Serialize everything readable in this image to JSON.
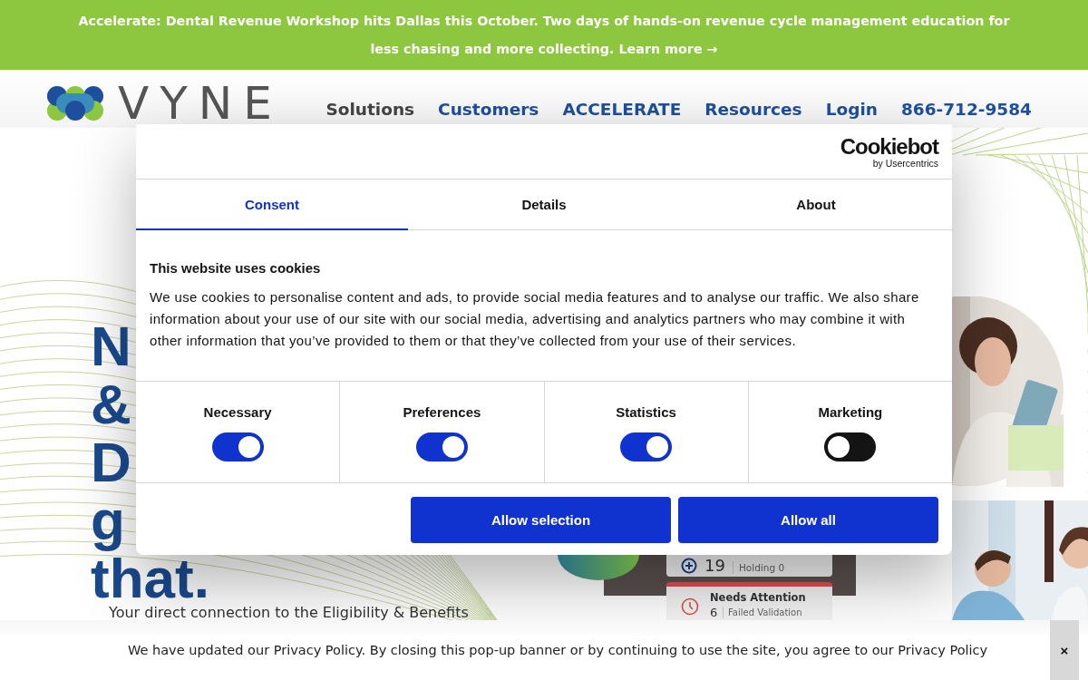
{
  "announcement": {
    "text": "Accelerate: Dental Revenue Workshop hits Dallas this October. Two days of hands-on revenue cycle management education for less chasing and more collecting.",
    "link": "Learn more →"
  },
  "header": {
    "logo": "VYNE",
    "nav": [
      {
        "label": "Solutions",
        "selected": true
      },
      {
        "label": "Customers",
        "selected": false
      },
      {
        "label": "ACCELERATE",
        "selected": false
      },
      {
        "label": "Resources",
        "selected": false
      },
      {
        "label": "Login",
        "selected": false
      },
      {
        "label": "866-712-9584",
        "selected": false
      }
    ]
  },
  "hero": {
    "headline": [
      "N",
      "&",
      "D",
      "g",
      "that."
    ],
    "subtitle": "Your direct connection to the Eligibility & Benefits"
  },
  "dashboard": {
    "count_1": "19",
    "status_1": "Holding 0",
    "title_2": "Needs Attention",
    "count_2": "6",
    "status_2": "Failed Validation"
  },
  "cookie_dialog": {
    "brand": "Cookiebot",
    "brand_sub": "by Usercentrics",
    "tabs": [
      {
        "label": "Consent",
        "selected": true
      },
      {
        "label": "Details",
        "selected": false
      },
      {
        "label": "About",
        "selected": false
      }
    ],
    "title": "This website uses cookies",
    "body": "We use cookies to personalise content and ads, to provide social media features and to analyse our traffic. We also share information about your use of our site with our social media, advertising and analytics partners who may combine it with other information that you’ve provided to them or that they’ve collected from your use of their services.",
    "categories": [
      {
        "label": "Necessary",
        "checked": true
      },
      {
        "label": "Preferences",
        "checked": true
      },
      {
        "label": "Statistics",
        "checked": true
      },
      {
        "label": "Marketing",
        "checked": false
      }
    ],
    "buttons": [
      "Allow selection",
      "Allow all"
    ]
  },
  "privacy_banner": {
    "text": "We have updated our Privacy Policy. By closing this pop-up banner or by continuing to use the site, you agree to our Privacy Policy",
    "close": "×"
  }
}
